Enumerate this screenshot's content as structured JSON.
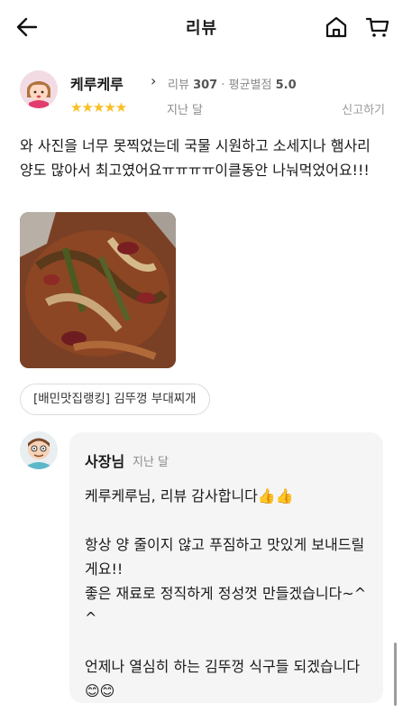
{
  "header": {
    "title": "리뷰",
    "back_icon": "arrow-left-icon",
    "home_icon": "home-icon",
    "cart_icon": "cart-icon"
  },
  "review": {
    "nickname": "케루케루",
    "chevron": "›",
    "stats_prefix": "리뷰",
    "review_count": "307",
    "dot": "·",
    "rating_prefix": "평균별점",
    "avg_rating": "5.0",
    "stars": "★★★★★",
    "rating": 5,
    "time": "지난 달",
    "report_label": "신고하기",
    "text": "와 사진을 너무 못찍었는데 국물 시원하고 소세지나 햄사리 양도 많아서 최고였어요ㅠㅠㅠㅠ이클동안 나눠먹었어요!!!",
    "menu_tag": "[배민맛집랭킹] 김뚜껑 부대찌개"
  },
  "owner_reply": {
    "name": "사장님",
    "time": "지난 달",
    "text": "케루케루님, 리뷰 감사합니다👍👍\n\n항상 양 줄이지 않고 푸짐하고 맛있게 보내드릴게요!!\n좋은 재료로 정직하게 정성껏 만들겠습니다~^^\n\n언제나 열심히 하는 김뚜껑 식구들 되겠습니다😊😊"
  },
  "colors": {
    "star": "#fbbf24",
    "muted": "#8a8a8a",
    "reply_bg": "#f5f5f5"
  }
}
